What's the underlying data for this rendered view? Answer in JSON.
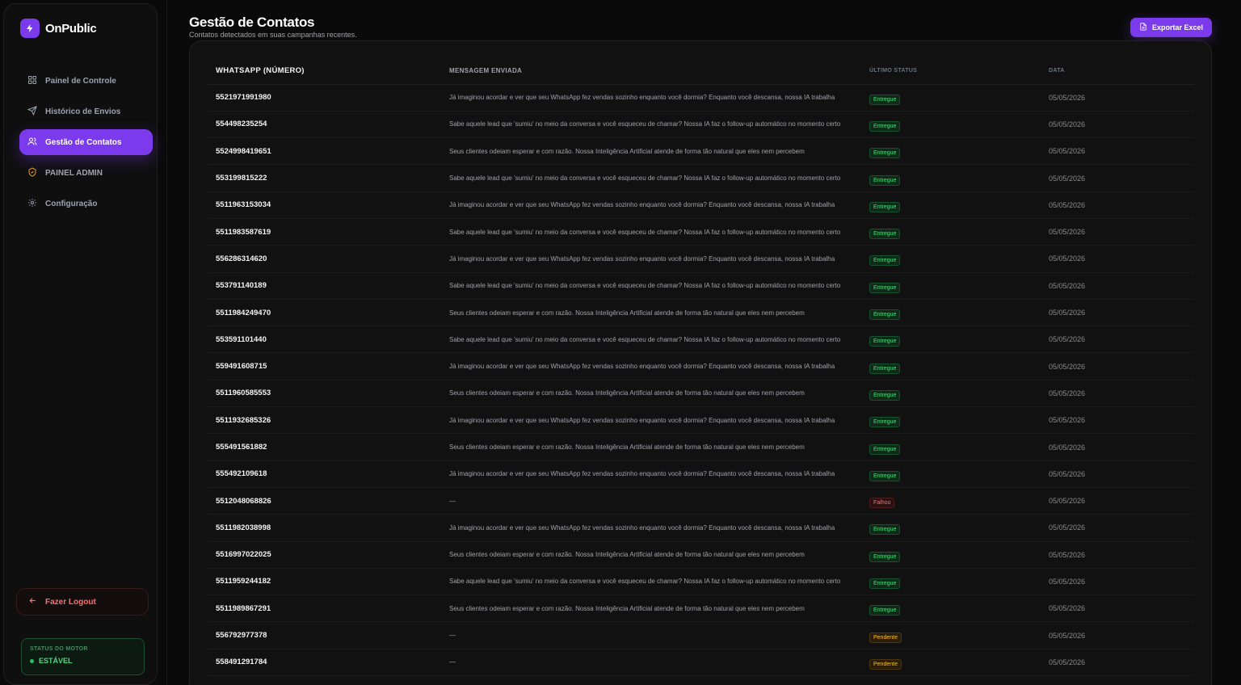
{
  "brand": {
    "name": "OnPublic",
    "accent": "#7c3aed"
  },
  "sidebar": {
    "items": [
      {
        "label": "Painel de Controle",
        "icon": "grid-icon",
        "active": false
      },
      {
        "label": "Histórico de Envios",
        "icon": "send-icon",
        "active": false
      },
      {
        "label": "Gestão de Contatos",
        "icon": "users-icon",
        "active": true
      },
      {
        "label": "PAINEL ADMIN",
        "icon": "shield-icon",
        "active": false
      },
      {
        "label": "Configuração",
        "icon": "gear-icon",
        "active": false
      }
    ],
    "logout_label": "Fazer Logout",
    "motor_label": "STATUS DO MOTOR",
    "motor_value": "ESTÁVEL"
  },
  "header": {
    "title": "Gestão de Contatos",
    "subtitle": "Contatos detectados em suas campanhas recentes.",
    "export_label": "Exportar Excel"
  },
  "table": {
    "columns": [
      "WHATSAPP (NÚMERO)",
      "MENSAGEM ENVIADA",
      "ÚLTIMO STATUS",
      "DATA"
    ],
    "rows": [
      {
        "number": "5521971991980",
        "message": "Já imaginou acordar e ver que seu WhatsApp fez vendas sozinho enquanto você dormia? Enquanto você descansa, nossa IA trabalha",
        "status": "Entregue",
        "date": "05/05/2026"
      },
      {
        "number": "554498235254",
        "message": "Sabe aquele lead que 'sumiu' no meio da conversa e você esqueceu de chamar? Nossa IA faz o follow-up automático no momento certo",
        "status": "Entregue",
        "date": "05/05/2026"
      },
      {
        "number": "5524998419651",
        "message": "Seus clientes odeiam esperar e com razão. Nossa Inteligência Artificial atende de forma tão natural que eles nem percebem",
        "status": "Entregue",
        "date": "05/05/2026"
      },
      {
        "number": "553199815222",
        "message": "Sabe aquele lead que 'sumiu' no meio da conversa e você esqueceu de chamar? Nossa IA faz o follow-up automático no momento certo",
        "status": "Entregue",
        "date": "05/05/2026"
      },
      {
        "number": "5511963153034",
        "message": "Já imaginou acordar e ver que seu WhatsApp fez vendas sozinho enquanto você dormia? Enquanto você descansa, nossa IA trabalha",
        "status": "Entregue",
        "date": "05/05/2026"
      },
      {
        "number": "5511983587619",
        "message": "Sabe aquele lead que 'sumiu' no meio da conversa e você esqueceu de chamar? Nossa IA faz o follow-up automático no momento certo",
        "status": "Entregue",
        "date": "05/05/2026"
      },
      {
        "number": "556286314620",
        "message": "Já imaginou acordar e ver que seu WhatsApp fez vendas sozinho enquanto você dormia? Enquanto você descansa, nossa IA trabalha",
        "status": "Entregue",
        "date": "05/05/2026"
      },
      {
        "number": "553791140189",
        "message": "Sabe aquele lead que 'sumiu' no meio da conversa e você esqueceu de chamar? Nossa IA faz o follow-up automático no momento certo",
        "status": "Entregue",
        "date": "05/05/2026"
      },
      {
        "number": "5511984249470",
        "message": "Seus clientes odeiam esperar e com razão. Nossa Inteligência Artificial atende de forma tão natural que eles nem percebem",
        "status": "Entregue",
        "date": "05/05/2026"
      },
      {
        "number": "553591101440",
        "message": "Sabe aquele lead que 'sumiu' no meio da conversa e você esqueceu de chamar? Nossa IA faz o follow-up automático no momento certo",
        "status": "Entregue",
        "date": "05/05/2026"
      },
      {
        "number": "559491608715",
        "message": "Já imaginou acordar e ver que seu WhatsApp fez vendas sozinho enquanto você dormia? Enquanto você descansa, nossa IA trabalha",
        "status": "Entregue",
        "date": "05/05/2026"
      },
      {
        "number": "5511960585553",
        "message": "Seus clientes odeiam esperar e com razão. Nossa Inteligência Artificial atende de forma tão natural que eles nem percebem",
        "status": "Entregue",
        "date": "05/05/2026"
      },
      {
        "number": "5511932685326",
        "message": "Já imaginou acordar e ver que seu WhatsApp fez vendas sozinho enquanto você dormia? Enquanto você descansa, nossa IA trabalha",
        "status": "Entregue",
        "date": "05/05/2026"
      },
      {
        "number": "555491561882",
        "message": "Seus clientes odeiam esperar e com razão. Nossa Inteligência Artificial atende de forma tão natural que eles nem percebem",
        "status": "Entregue",
        "date": "05/05/2026"
      },
      {
        "number": "555492109618",
        "message": "Já imaginou acordar e ver que seu WhatsApp fez vendas sozinho enquanto você dormia? Enquanto você descansa, nossa IA trabalha",
        "status": "Entregue",
        "date": "05/05/2026"
      },
      {
        "number": "5512048068826",
        "message": "—",
        "status": "Falhou",
        "date": "05/05/2026"
      },
      {
        "number": "5511982038998",
        "message": "Já imaginou acordar e ver que seu WhatsApp fez vendas sozinho enquanto você dormia? Enquanto você descansa, nossa IA trabalha",
        "status": "Entregue",
        "date": "05/05/2026"
      },
      {
        "number": "5516997022025",
        "message": "Seus clientes odeiam esperar e com razão. Nossa Inteligência Artificial atende de forma tão natural que eles nem percebem",
        "status": "Entregue",
        "date": "05/05/2026"
      },
      {
        "number": "5511959244182",
        "message": "Sabe aquele lead que 'sumiu' no meio da conversa e você esqueceu de chamar? Nossa IA faz o follow-up automático no momento certo",
        "status": "Entregue",
        "date": "05/05/2026"
      },
      {
        "number": "5511989867291",
        "message": "Seus clientes odeiam esperar e com razão. Nossa Inteligência Artificial atende de forma tão natural que eles nem percebem",
        "status": "Entregue",
        "date": "05/05/2026"
      },
      {
        "number": "556792977378",
        "message": "—",
        "status": "Pendente",
        "date": "05/05/2026"
      },
      {
        "number": "558491291784",
        "message": "—",
        "status": "Pendente",
        "date": "05/05/2026"
      }
    ]
  },
  "status_colors": {
    "Entregue": "#4ade80",
    "Falhou": "#f87171",
    "Pendente": "#fbbf24"
  }
}
